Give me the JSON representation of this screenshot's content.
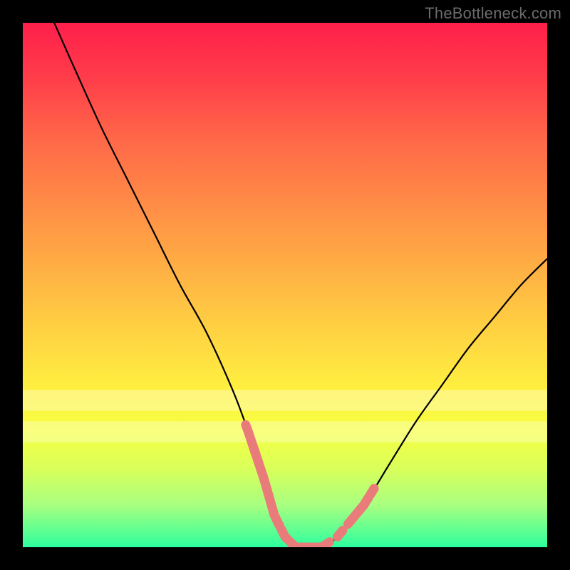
{
  "watermark": {
    "text": "TheBottleneck.com"
  },
  "chart_data": {
    "type": "line",
    "title": "",
    "xlabel": "",
    "ylabel": "",
    "xlim": [
      0,
      100
    ],
    "ylim": [
      0,
      100
    ],
    "grid": false,
    "legend": false,
    "series": [
      {
        "name": "bottleneck-curve",
        "x": [
          6,
          10,
          15,
          20,
          25,
          30,
          35,
          40,
          43,
          46,
          48,
          50,
          52,
          54,
          57,
          60,
          65,
          70,
          75,
          80,
          85,
          90,
          95,
          100
        ],
        "y": [
          100,
          91,
          80,
          70,
          60,
          50,
          41,
          30,
          22,
          13,
          6,
          2,
          0,
          0,
          0,
          2,
          8,
          16,
          24,
          31,
          38,
          44,
          50,
          55
        ]
      }
    ],
    "highlight_segments": [
      {
        "x0": 42.5,
        "x1": 44.5
      },
      {
        "x0": 44.8,
        "x1": 49.0
      },
      {
        "x0": 49.3,
        "x1": 50.5
      },
      {
        "x0": 50.8,
        "x1": 53.0
      },
      {
        "x0": 53.2,
        "x1": 54.0
      },
      {
        "x0": 54.5,
        "x1": 57.5
      },
      {
        "x0": 57.8,
        "x1": 58.5
      },
      {
        "x0": 60.0,
        "x1": 61.0
      },
      {
        "x0": 62.0,
        "x1": 66.0
      },
      {
        "x0": 66.3,
        "x1": 67.0
      },
      {
        "x0": 44.0,
        "x1": 45.0
      }
    ],
    "pale_bands_y": [
      {
        "y0": 26,
        "y1": 30
      },
      {
        "y0": 20,
        "y1": 24
      }
    ]
  }
}
